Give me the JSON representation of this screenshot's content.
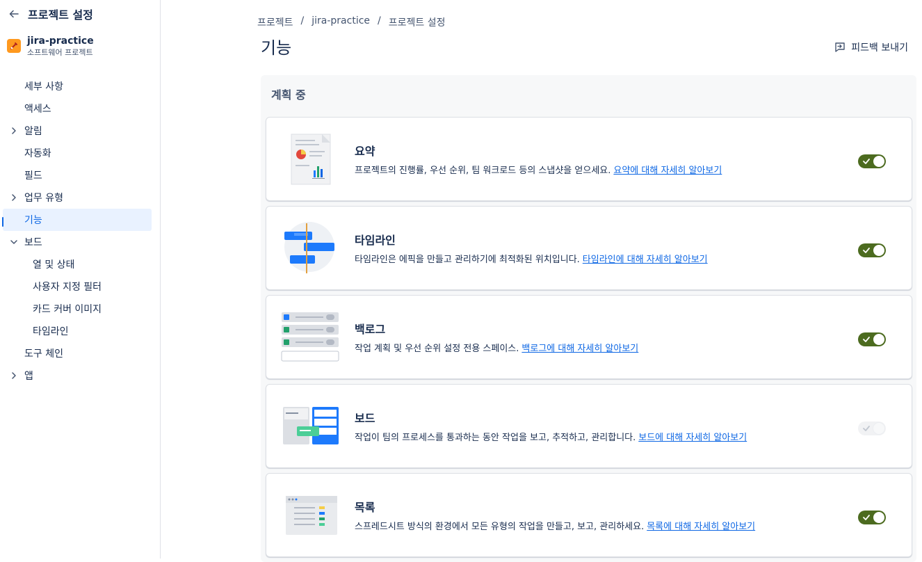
{
  "sidebar": {
    "back_title": "프로젝트 설정",
    "project": {
      "name": "jira-practice",
      "type": "소프트웨어 프로젝트"
    },
    "items": [
      {
        "label": "세부 사항"
      },
      {
        "label": "액세스"
      },
      {
        "label": "알림",
        "chevron": "right"
      },
      {
        "label": "자동화"
      },
      {
        "label": "필드"
      },
      {
        "label": "업무 유형",
        "chevron": "right"
      },
      {
        "label": "기능",
        "active": true
      },
      {
        "label": "보드",
        "chevron": "down"
      },
      {
        "label": "열 및 상태",
        "sub": true
      },
      {
        "label": "사용자 지정 필터",
        "sub": true
      },
      {
        "label": "카드 커버 이미지",
        "sub": true
      },
      {
        "label": "타임라인",
        "sub": true
      },
      {
        "label": "도구 체인"
      },
      {
        "label": "앱",
        "chevron": "right"
      }
    ]
  },
  "breadcrumb": [
    "프로젝트",
    "jira-practice",
    "프로젝트 설정"
  ],
  "page_title": "기능",
  "feedback_label": "피드백 보내기",
  "section_title": "계획 중",
  "features": [
    {
      "title": "요약",
      "desc": "프로젝트의 진행률, 우선 순위, 팀 워크로드 등의 스냅샷을 얻으세요.",
      "link": "요약에 대해 자세히 알아보기",
      "enabled": true
    },
    {
      "title": "타임라인",
      "desc": "타임라인은 에픽을 만들고 관리하기에 최적화된 위치입니다.",
      "link": "타임라인에 대해 자세히 알아보기",
      "enabled": true
    },
    {
      "title": "백로그",
      "desc": "작업 계획 및 우선 순위 설정 전용 스페이스.",
      "link": "백로그에 대해 자세히 알아보기",
      "enabled": true
    },
    {
      "title": "보드",
      "desc": "작업이 팀의 프로세스를 통과하는 동안 작업을 보고, 추적하고, 관리합니다.",
      "link": "보드에 대해 자세히 알아보기",
      "enabled": false
    },
    {
      "title": "목록",
      "desc": "스프레드시트 방식의 환경에서 모든 유형의 작업을 만들고, 보고, 관리하세요.",
      "link": "목록에 대해 자세히 알아보기",
      "enabled": true
    }
  ],
  "colors": {
    "accent": "#0c66e4",
    "toggle_on": "#4c6b1f",
    "project_logo": "#ff991f"
  }
}
